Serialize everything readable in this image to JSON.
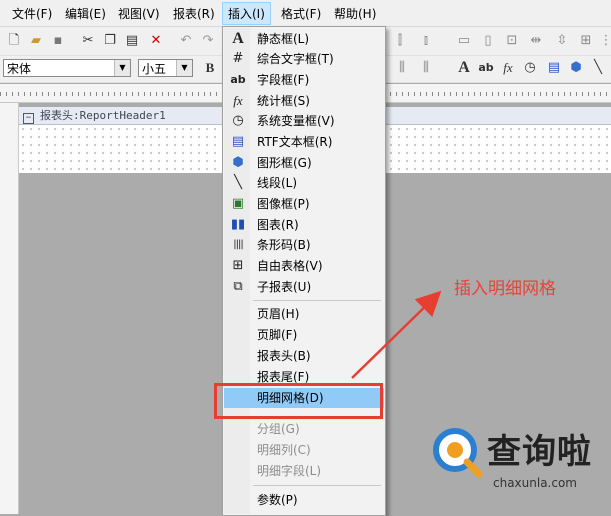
{
  "menubar": {
    "items": [
      {
        "label": "文件(F)"
      },
      {
        "label": "编辑(E)"
      },
      {
        "label": "视图(V)"
      },
      {
        "label": "报表(R)"
      },
      {
        "label": "插入(I)",
        "active": true
      },
      {
        "label": "格式(F)"
      },
      {
        "label": "帮助(H)"
      }
    ]
  },
  "toolbar": {
    "font_name": "宋体",
    "font_size": "小五",
    "bold_label": "B"
  },
  "report": {
    "band_header_label": "报表头:ReportHeader1"
  },
  "insert_menu": {
    "items": [
      {
        "label": "静态框(L)",
        "icon": "static-text-icon",
        "glyph": "A",
        "enabled": true
      },
      {
        "label": "综合文字框(T)",
        "icon": "composite-text-icon",
        "glyph": "#",
        "enabled": true
      },
      {
        "label": "字段框(F)",
        "icon": "field-box-icon",
        "glyph": "ab",
        "enabled": true
      },
      {
        "label": "统计框(S)",
        "icon": "summary-fx-icon",
        "glyph": "fx",
        "enabled": true
      },
      {
        "label": "系统变量框(V)",
        "icon": "system-var-clock-icon",
        "glyph": "◷",
        "enabled": true
      },
      {
        "label": "RTF文本框(R)",
        "icon": "rtf-text-icon",
        "glyph": "▤",
        "enabled": true
      },
      {
        "label": "图形框(G)",
        "icon": "shape-box-icon",
        "glyph": "⬢",
        "enabled": true
      },
      {
        "label": "线段(L)",
        "icon": "line-icon",
        "glyph": "╲",
        "enabled": true
      },
      {
        "label": "图像框(P)",
        "icon": "image-box-icon",
        "glyph": "▣",
        "enabled": true
      },
      {
        "label": "图表(R)",
        "icon": "chart-icon",
        "glyph": "▮",
        "enabled": true
      },
      {
        "label": "条形码(B)",
        "icon": "barcode-icon",
        "glyph": "|||",
        "enabled": true
      },
      {
        "label": "自由表格(V)",
        "icon": "free-grid-icon",
        "glyph": "⊞",
        "enabled": true
      },
      {
        "label": "子报表(U)",
        "icon": "subreport-icon",
        "glyph": "⧉",
        "enabled": true
      },
      {
        "separator": true
      },
      {
        "label": "页眉(H)",
        "enabled": true
      },
      {
        "label": "页脚(F)",
        "enabled": true
      },
      {
        "label": "报表头(B)",
        "enabled": true
      },
      {
        "label": "报表尾(F)",
        "enabled": true
      },
      {
        "label": "明细网格(D)",
        "enabled": true,
        "selected": true
      },
      {
        "label": "分组(G)",
        "enabled": false
      },
      {
        "label": "明细列(C)",
        "enabled": false
      },
      {
        "label": "明细字段(L)",
        "enabled": false
      },
      {
        "separator": true
      },
      {
        "label": "参数(P)",
        "enabled": true
      }
    ]
  },
  "annotation": {
    "text": "插入明细网格",
    "color": "#e8423a"
  },
  "watermark": {
    "brand": "查询啦",
    "url": "chaxunla.com"
  },
  "colors": {
    "menu_highlight": "#cce8ff",
    "selected_item": "#91c9f7",
    "annotation_red": "#e63f32",
    "workspace_gray": "#ababab"
  }
}
